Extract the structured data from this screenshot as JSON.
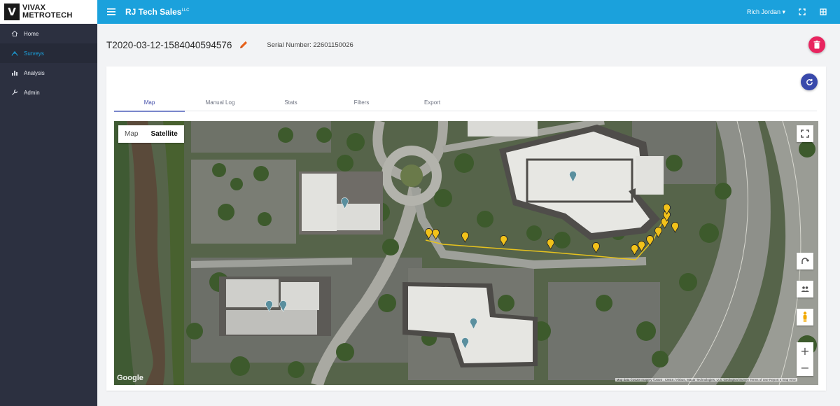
{
  "brand": {
    "mark": "V",
    "line1": "VIVAX",
    "line2": "METROTECH"
  },
  "header": {
    "title": "RJ Tech Sales",
    "title_suffix": "LLC",
    "user": "Rich Jordan ▾"
  },
  "sidebar": {
    "items": [
      {
        "label": "Home",
        "icon": "home-icon"
      },
      {
        "label": "Surveys",
        "icon": "surveys-icon"
      },
      {
        "label": "Analysis",
        "icon": "analysis-icon"
      },
      {
        "label": "Admin",
        "icon": "admin-icon"
      }
    ],
    "active": "Surveys"
  },
  "survey": {
    "id": "T2020-03-12-1584040594576",
    "serial_label": "Serial Number: 22601150026"
  },
  "tabs": [
    "Map",
    "Manual Log",
    "Stats",
    "Filters",
    "Export"
  ],
  "active_tab": "Map",
  "map": {
    "type_options": [
      "Map",
      "Satellite"
    ],
    "selected_type": "Satellite",
    "google": "Google",
    "attribution": "Map data ©2020 Imagery ©2020 , CNES / Airbus, Maxar Technologies, U.S. Geological Survey   Terms of Use   Report a map error"
  },
  "colors": {
    "accent": "#1ba1dc",
    "sidebar": "#2c3040",
    "delete": "#e8245f",
    "refresh": "#3949ab",
    "tab_active": "#3f4aa8",
    "marker": "#f2c21a"
  }
}
